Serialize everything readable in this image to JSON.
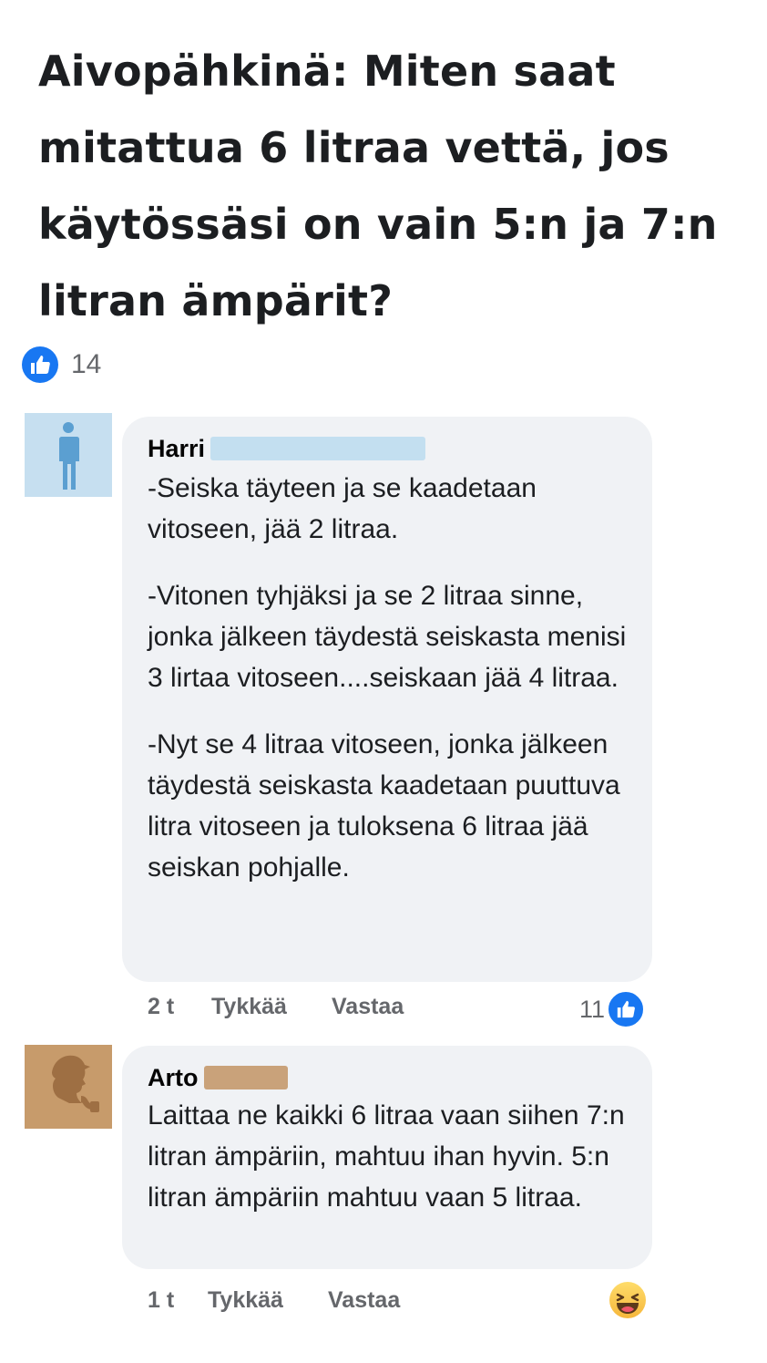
{
  "post": {
    "title": "Aivopähkinä: Miten saat mitattua 6 litraa vettä, jos käytössäsi on vain 5:n ja 7:n litran ämpärit?",
    "reaction_icon": "like-icon",
    "reaction_count": "14"
  },
  "comments": [
    {
      "author": "Harri",
      "avatar_icon": "person-silhouette-icon",
      "paragraphs": [
        "-Seiska täyteen ja se kaadetaan vitoseen, jää 2 litraa.",
        "-Vitonen tyhjäksi ja se 2 litraa sinne, jonka jälkeen täydestä seiskasta menisi 3 lirtaa vitoseen....seiskaan jää 4 litraa.",
        "-Nyt se 4 litraa vitoseen, jonka jälkeen täydestä seiskasta kaadetaan puuttuva litra vitoseen ja tuloksena 6 litraa jää seiskan pohjalle."
      ],
      "time": "2 t",
      "like_label": "Tykkää",
      "reply_label": "Vastaa",
      "reaction_count": "11",
      "reaction_icon": "like-icon"
    },
    {
      "author": "Arto",
      "avatar_icon": "detective-silhouette-icon",
      "paragraphs": [
        "Laittaa ne kaikki 6 litraa vaan siihen 7:n litran ämpäriin, mahtuu ihan hyvin. 5:n litran ämpäriin mahtuu vaan 5 litraa."
      ],
      "time": "1 t",
      "like_label": "Tykkää",
      "reply_label": "Vastaa",
      "reaction_icon": "haha-icon"
    }
  ],
  "colors": {
    "accent": "#1877f2",
    "bubble": "#f0f2f5",
    "muted_text": "#65676b"
  }
}
